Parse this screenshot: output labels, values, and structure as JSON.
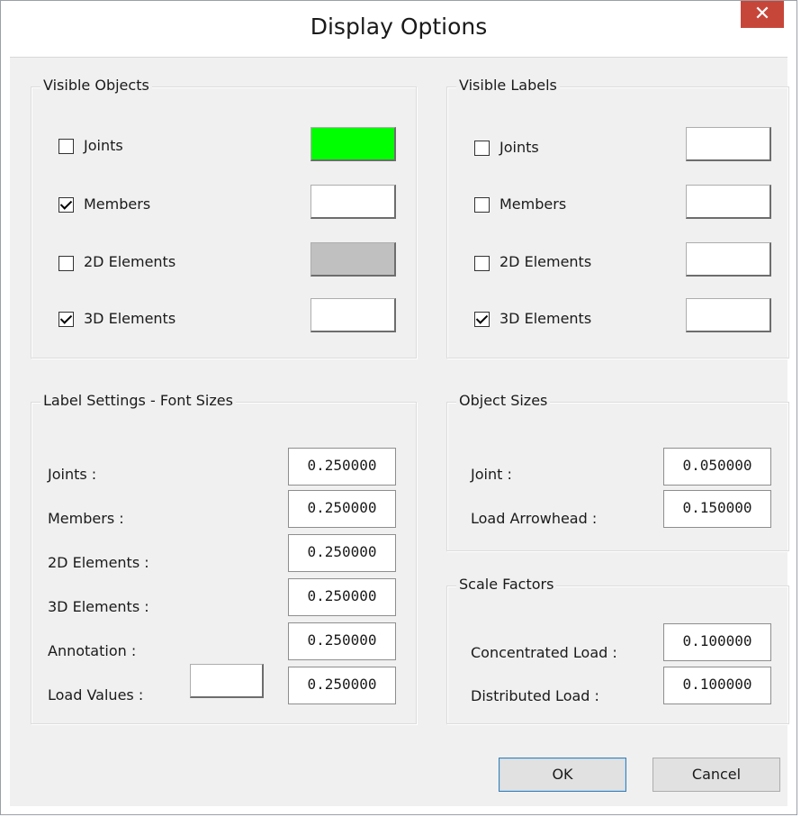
{
  "dialog": {
    "title": "Display Options",
    "close_glyph": "✕"
  },
  "visible_objects": {
    "title": "Visible Objects",
    "items": [
      {
        "label": "Joints",
        "checked": false,
        "color": "#00ff00"
      },
      {
        "label": "Members",
        "checked": true,
        "color": "#ffffff"
      },
      {
        "label": "2D Elements",
        "checked": false,
        "color": "#c0c0c0"
      },
      {
        "label": "3D Elements",
        "checked": true,
        "color": "#ffffff"
      }
    ]
  },
  "visible_labels": {
    "title": "Visible Labels",
    "items": [
      {
        "label": "Joints",
        "checked": false,
        "color": "#ffffff"
      },
      {
        "label": "Members",
        "checked": false,
        "color": "#ffffff"
      },
      {
        "label": "2D Elements",
        "checked": false,
        "color": "#ffffff"
      },
      {
        "label": "3D Elements",
        "checked": true,
        "color": "#ffffff"
      }
    ]
  },
  "label_settings": {
    "title": "Label Settings - Font Sizes",
    "rows": [
      {
        "label": "Joints :",
        "value": "0.250000"
      },
      {
        "label": "Members :",
        "value": "0.250000"
      },
      {
        "label": "2D Elements :",
        "value": "0.250000"
      },
      {
        "label": "3D Elements :",
        "value": "0.250000"
      },
      {
        "label": "Annotation :",
        "value": "0.250000"
      },
      {
        "label": "Load Values :",
        "value": "0.250000",
        "color": "#ffffff"
      }
    ]
  },
  "object_sizes": {
    "title": "Object Sizes",
    "rows": [
      {
        "label": "Joint :",
        "value": "0.050000"
      },
      {
        "label": "Load Arrowhead :",
        "value": "0.150000"
      }
    ]
  },
  "scale_factors": {
    "title": "Scale Factors",
    "rows": [
      {
        "label": "Concentrated Load :",
        "value": "0.100000"
      },
      {
        "label": "Distributed Load :",
        "value": "0.100000"
      }
    ]
  },
  "buttons": {
    "ok": "OK",
    "cancel": "Cancel"
  }
}
